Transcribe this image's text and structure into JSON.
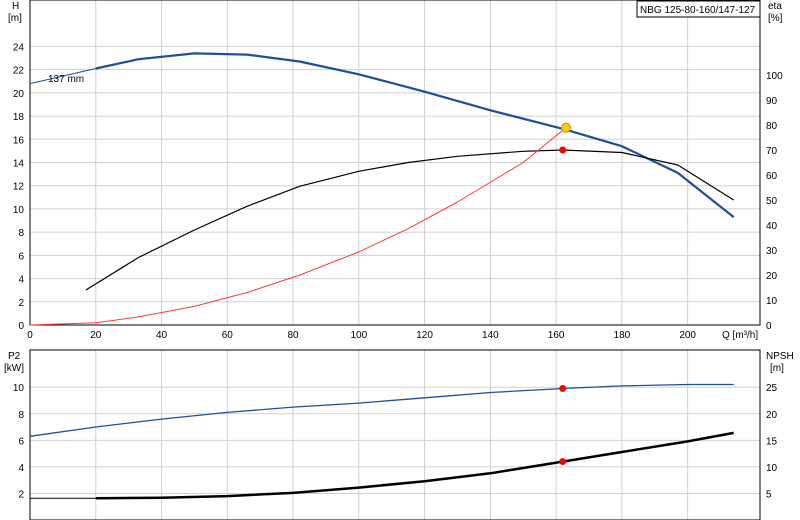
{
  "model_label": "NBG 125-80-160/147-127",
  "colors": {
    "head": "#1f4e9a",
    "eta": "#000000",
    "system": "#ff3a3a",
    "p2": "#1f4e9a",
    "npsh": "#000000",
    "operating_point": "#ff0000",
    "duty_point": "#ffcc00"
  },
  "chart_data": [
    {
      "type": "line",
      "panel": "upper",
      "xlabel": "Q [m³/h]",
      "ylabel": "H\n[m]",
      "y2label": "eta\n[%]",
      "xlim": [
        0,
        222
      ],
      "ylim": [
        0,
        28
      ],
      "y2lim": [
        0,
        130
      ],
      "xticks": [
        0,
        20,
        40,
        60,
        80,
        100,
        120,
        140,
        160,
        180,
        200
      ],
      "yticks": [
        0,
        2,
        4,
        6,
        8,
        10,
        12,
        14,
        16,
        18,
        20,
        22,
        24
      ],
      "y2ticks": [
        0,
        10,
        20,
        30,
        40,
        50,
        60,
        70,
        80,
        90,
        100
      ],
      "grid": true,
      "annotation": "137 mm",
      "series": [
        {
          "key": "head",
          "axis": "left",
          "x": [
            0,
            20,
            33,
            50,
            66,
            82,
            100,
            120,
            140,
            162,
            180,
            197,
            214
          ],
          "y": [
            20.8,
            22.1,
            22.9,
            23.4,
            23.3,
            22.7,
            21.6,
            20.1,
            18.5,
            16.9,
            15.4,
            13.1,
            9.3
          ]
        },
        {
          "key": "eta",
          "axis": "right",
          "x": [
            17,
            33,
            50,
            66,
            82,
            100,
            115,
            130,
            150,
            162,
            180,
            197,
            214
          ],
          "y": [
            14,
            27,
            38,
            47.5,
            55.5,
            61.5,
            65,
            67.5,
            69.5,
            70,
            69,
            64,
            50
          ]
        },
        {
          "key": "system",
          "axis": "left",
          "x": [
            0,
            20,
            33,
            50,
            66,
            82,
            100,
            115,
            130,
            150,
            163
          ],
          "y": [
            0,
            0.2,
            0.7,
            1.6,
            2.8,
            4.3,
            6.3,
            8.3,
            10.6,
            14.0,
            17.0
          ]
        }
      ],
      "points": [
        {
          "key": "duty",
          "axis": "left",
          "x": 163,
          "y": 17.0
        },
        {
          "key": "op_eta",
          "axis": "right",
          "x": 162,
          "y": 70
        }
      ]
    },
    {
      "type": "line",
      "panel": "lower",
      "ylabel": "P2\n[kW]",
      "y2label": "NPSH\n[m]",
      "xlim": [
        0,
        222
      ],
      "ylim": [
        0,
        12.8
      ],
      "y2lim": [
        0,
        32
      ],
      "yticks": [
        2,
        4,
        6,
        8,
        10
      ],
      "y2ticks": [
        5,
        10,
        15,
        20,
        25
      ],
      "grid": true,
      "series": [
        {
          "key": "p2",
          "axis": "left",
          "x": [
            0,
            20,
            40,
            60,
            80,
            100,
            120,
            140,
            162,
            180,
            200,
            214
          ],
          "y": [
            6.3,
            7.0,
            7.6,
            8.1,
            8.5,
            8.8,
            9.2,
            9.6,
            9.9,
            10.1,
            10.2,
            10.2
          ]
        },
        {
          "key": "npsh",
          "axis": "right",
          "x": [
            0,
            20,
            40,
            60,
            80,
            100,
            120,
            140,
            162,
            180,
            200,
            214
          ],
          "y": [
            4.1,
            4.1,
            4.2,
            4.5,
            5.1,
            6.1,
            7.3,
            8.8,
            11.0,
            12.8,
            14.8,
            16.4
          ]
        }
      ],
      "points": [
        {
          "key": "op_p2",
          "axis": "left",
          "x": 162,
          "y": 9.9
        },
        {
          "key": "op_npsh",
          "axis": "right",
          "x": 162,
          "y": 11.0
        }
      ]
    }
  ]
}
